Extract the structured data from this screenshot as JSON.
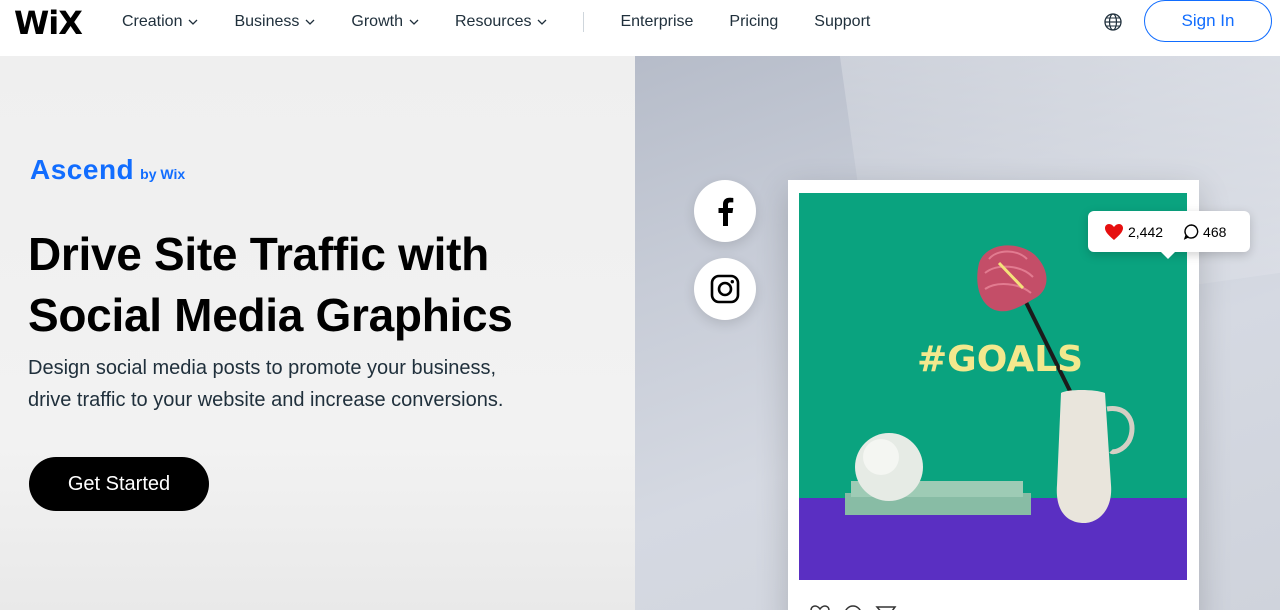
{
  "header": {
    "logo": "WiX",
    "nav": [
      {
        "label": "Creation",
        "has_dropdown": true
      },
      {
        "label": "Business",
        "has_dropdown": true
      },
      {
        "label": "Growth",
        "has_dropdown": true
      },
      {
        "label": "Resources",
        "has_dropdown": true
      },
      {
        "label": "Enterprise",
        "has_dropdown": false
      },
      {
        "label": "Pricing",
        "has_dropdown": false
      },
      {
        "label": "Support",
        "has_dropdown": false
      }
    ],
    "language_icon": "globe-icon",
    "sign_in_label": "Sign In"
  },
  "hero": {
    "brand_name": "Ascend",
    "brand_by": "by Wix",
    "title_line1": "Drive Site Traffic with",
    "title_line2": "Social Media Graphics",
    "subtitle_line1": "Design social media posts to promote your business,",
    "subtitle_line2": "drive traffic to your website and increase conversions.",
    "cta_label": "Get Started"
  },
  "showcase": {
    "social_icons": [
      "facebook-icon",
      "instagram-icon"
    ],
    "post_text": "#GOALS",
    "likes": "2,442",
    "comments": "468"
  },
  "colors": {
    "accent": "#116dff",
    "cta_bg": "#000000",
    "post_green": "#0aa37f",
    "post_purple": "#5a2fc2",
    "post_text": "#f3e88d"
  }
}
